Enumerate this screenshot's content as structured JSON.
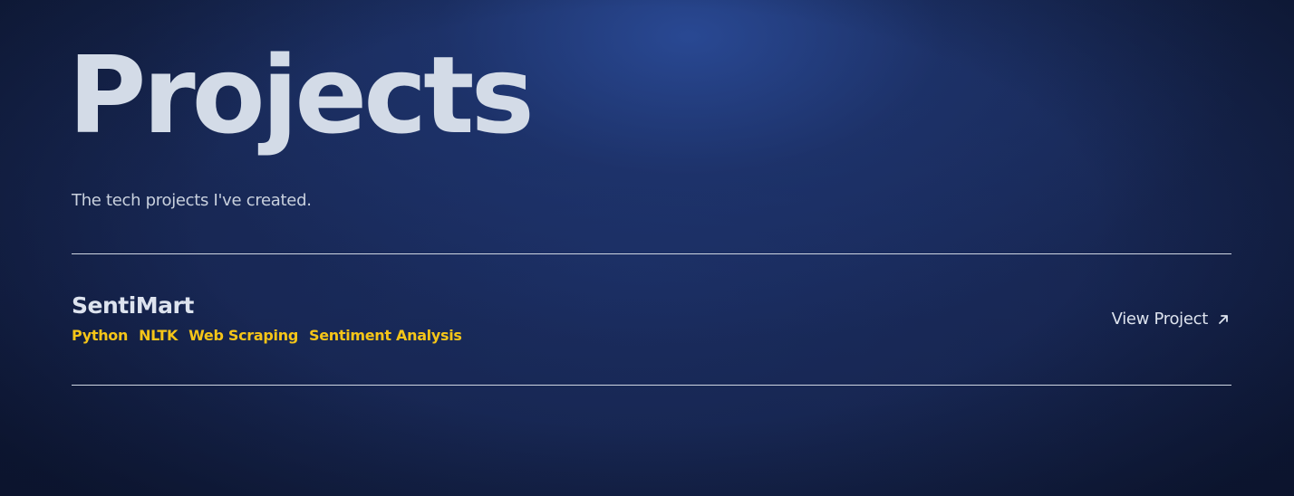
{
  "header": {
    "title": "Projects",
    "subtitle": "The tech projects I've created."
  },
  "projects": [
    {
      "name": "SentiMart",
      "tags": [
        "Python",
        "NLTK",
        "Web Scraping",
        "Sentiment Analysis"
      ],
      "link_label": "View Project",
      "link_icon": "arrow-up-right-icon"
    }
  ],
  "colors": {
    "background": "#16244a",
    "accent_tag": "#f5c518",
    "text": "#d3dbe7"
  }
}
